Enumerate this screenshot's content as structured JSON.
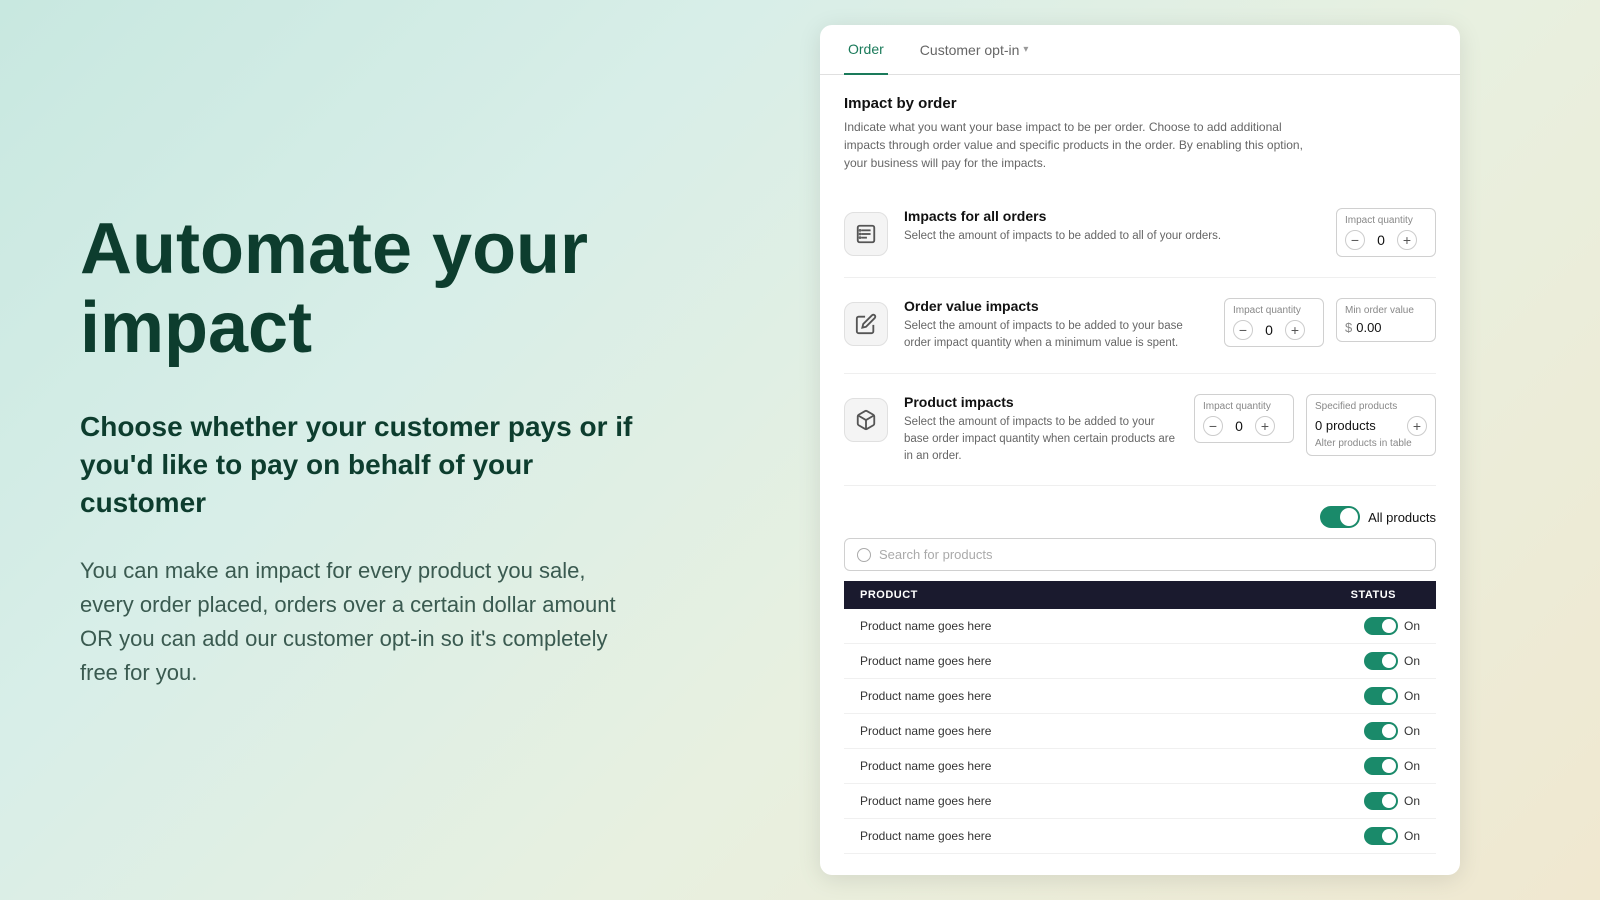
{
  "left": {
    "headline": "Automate your impact",
    "subheadline": "Choose whether your customer pays or if you'd like to pay on behalf of your customer",
    "body": "You can make an impact for every product you sale, every order placed, orders over a certain dollar amount OR you can add our customer opt-in so it's completely free for you."
  },
  "tabs": [
    {
      "label": "Order",
      "active": true
    },
    {
      "label": "Customer opt-in",
      "active": false,
      "hasChevron": true
    }
  ],
  "impact_by_order": {
    "title": "Impact by order",
    "description": "Indicate what you want your base impact to be per order. Choose to add additional impacts through order value and specific products in the order. By enabling this option, your business will pay for the impacts."
  },
  "sections": [
    {
      "id": "all-orders",
      "icon": "list-icon",
      "title": "Impacts for all orders",
      "description": "Select the amount of impacts to be added to all of your orders.",
      "fields": [
        {
          "label": "Impact quantity",
          "type": "stepper",
          "value": "0"
        }
      ]
    },
    {
      "id": "order-value",
      "icon": "edit-icon",
      "title": "Order value impacts",
      "description": "Select the amount of impacts to be added to your base order impact quantity when a minimum value is spent.",
      "fields": [
        {
          "label": "Impact quantity",
          "type": "stepper",
          "value": "0"
        },
        {
          "label": "Min order value",
          "type": "currency",
          "currency_symbol": "$",
          "value": "0.00"
        }
      ]
    },
    {
      "id": "product-impacts",
      "icon": "box-icon",
      "title": "Product impacts",
      "description": "Select the amount of impacts to be added to your base order impact quantity when certain products are in an order.",
      "fields": [
        {
          "label": "Impact quantity",
          "type": "stepper",
          "value": "0"
        },
        {
          "label": "Specified products",
          "type": "products",
          "value": "0 products",
          "alter_text": "Alter products in table"
        }
      ]
    }
  ],
  "all_products_toggle": {
    "label": "All products",
    "enabled": true
  },
  "search": {
    "placeholder": "Search for products"
  },
  "table": {
    "headers": [
      "Product",
      "Status"
    ],
    "rows": [
      {
        "name": "Product name goes here",
        "status": "On"
      },
      {
        "name": "Product name goes here",
        "status": "On"
      },
      {
        "name": "Product name goes here",
        "status": "On"
      },
      {
        "name": "Product name goes here",
        "status": "On"
      },
      {
        "name": "Product name goes here",
        "status": "On"
      },
      {
        "name": "Product name goes here",
        "status": "On"
      },
      {
        "name": "Product name goes here",
        "status": "On"
      }
    ]
  }
}
